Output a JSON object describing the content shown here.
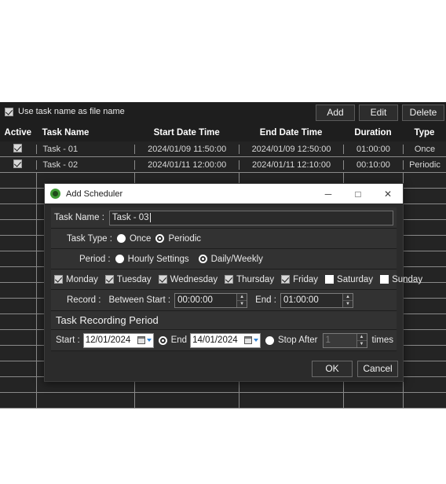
{
  "background": {
    "file_name_checkbox": {
      "label": "Use task name as file name",
      "checked": true
    },
    "buttons": {
      "add": "Add",
      "edit": "Edit",
      "delete": "Delete"
    },
    "table": {
      "headers": [
        "Active",
        "Task Name",
        "Start Date Time",
        "End Date Time",
        "Duration",
        "Type"
      ],
      "rows": [
        {
          "active": true,
          "task_name": "Task - 01",
          "start": "2024/01/09 11:50:00",
          "end": "2024/01/09 12:50:00",
          "duration": "01:00:00",
          "type": "Once"
        },
        {
          "active": true,
          "task_name": "Task - 02",
          "start": "2024/01/11 12:00:00",
          "end": "2024/01/11 12:10:00",
          "duration": "00:10:00",
          "type": "Periodic"
        }
      ],
      "empty_row_count": 15
    }
  },
  "dialog": {
    "title": "Add Scheduler",
    "icon": "app-icon",
    "window_controls": {
      "minimize": "─",
      "maximize": "□",
      "close": "✕"
    },
    "task_name": {
      "label": "Task Name :",
      "value": "Task - 03"
    },
    "task_type": {
      "label": "Task Type :",
      "options": [
        {
          "label": "Once",
          "selected": false
        },
        {
          "label": "Periodic",
          "selected": true
        }
      ]
    },
    "period": {
      "label": "Period :",
      "options": [
        {
          "label": "Hourly Settings",
          "selected": false
        },
        {
          "label": "Daily/Weekly",
          "selected": true
        }
      ]
    },
    "weekdays": [
      {
        "label": "Monday",
        "checked": true
      },
      {
        "label": "Tuesday",
        "checked": true
      },
      {
        "label": "Wednesday",
        "checked": true
      },
      {
        "label": "Thursday",
        "checked": true
      },
      {
        "label": "Friday",
        "checked": true
      },
      {
        "label": "Saturday",
        "checked": false
      },
      {
        "label": "Sunday",
        "checked": false
      }
    ],
    "record": {
      "label": "Record :",
      "start_label": "Between Start :",
      "start_value": "00:00:00",
      "end_label": "End :",
      "end_value": "01:00:00"
    },
    "recording_period": {
      "section_title": "Task Recording Period",
      "start_label": "Start :",
      "start_date": "12/01/2024",
      "end_label": "End",
      "end_selected": true,
      "end_date": "14/01/2024",
      "stop_after_label": "Stop After",
      "stop_after_selected": false,
      "stop_after_value": "1",
      "times_label": "times"
    },
    "footer": {
      "ok": "OK",
      "cancel": "Cancel"
    }
  }
}
